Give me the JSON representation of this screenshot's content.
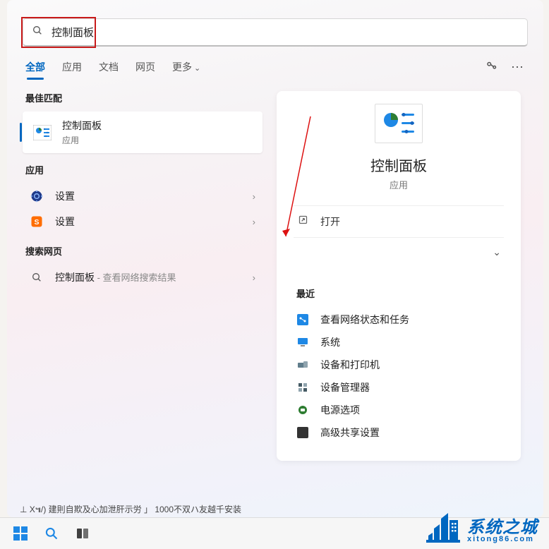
{
  "search": {
    "value": "控制面板"
  },
  "tabs": {
    "all": "全部",
    "apps": "应用",
    "docs": "文档",
    "web": "网页",
    "more": "更多"
  },
  "left": {
    "best_match_label": "最佳匹配",
    "best_match": {
      "title": "控制面板",
      "subtitle": "应用"
    },
    "apps_label": "应用",
    "apps": [
      {
        "name": "设置"
      },
      {
        "name": "设置"
      }
    ],
    "web_label": "搜索网页",
    "web_item": {
      "prefix": "控制面板",
      "suffix": " - 查看网络搜索结果"
    }
  },
  "preview": {
    "title": "控制面板",
    "subtitle": "应用",
    "action_open": "打开",
    "recent_label": "最近",
    "recent_items": [
      "查看网络状态和任务",
      "系统",
      "设备和打印机",
      "设备管理器",
      "电源选项",
      "高级共享设置"
    ]
  },
  "misc": {
    "truncated": "⊥ Χ๚/) 建則自欺及心加泄肝示労 」 1000不双ハ友越千安装"
  },
  "watermark": {
    "title": "系统之城",
    "domain": "xitong86.com"
  }
}
